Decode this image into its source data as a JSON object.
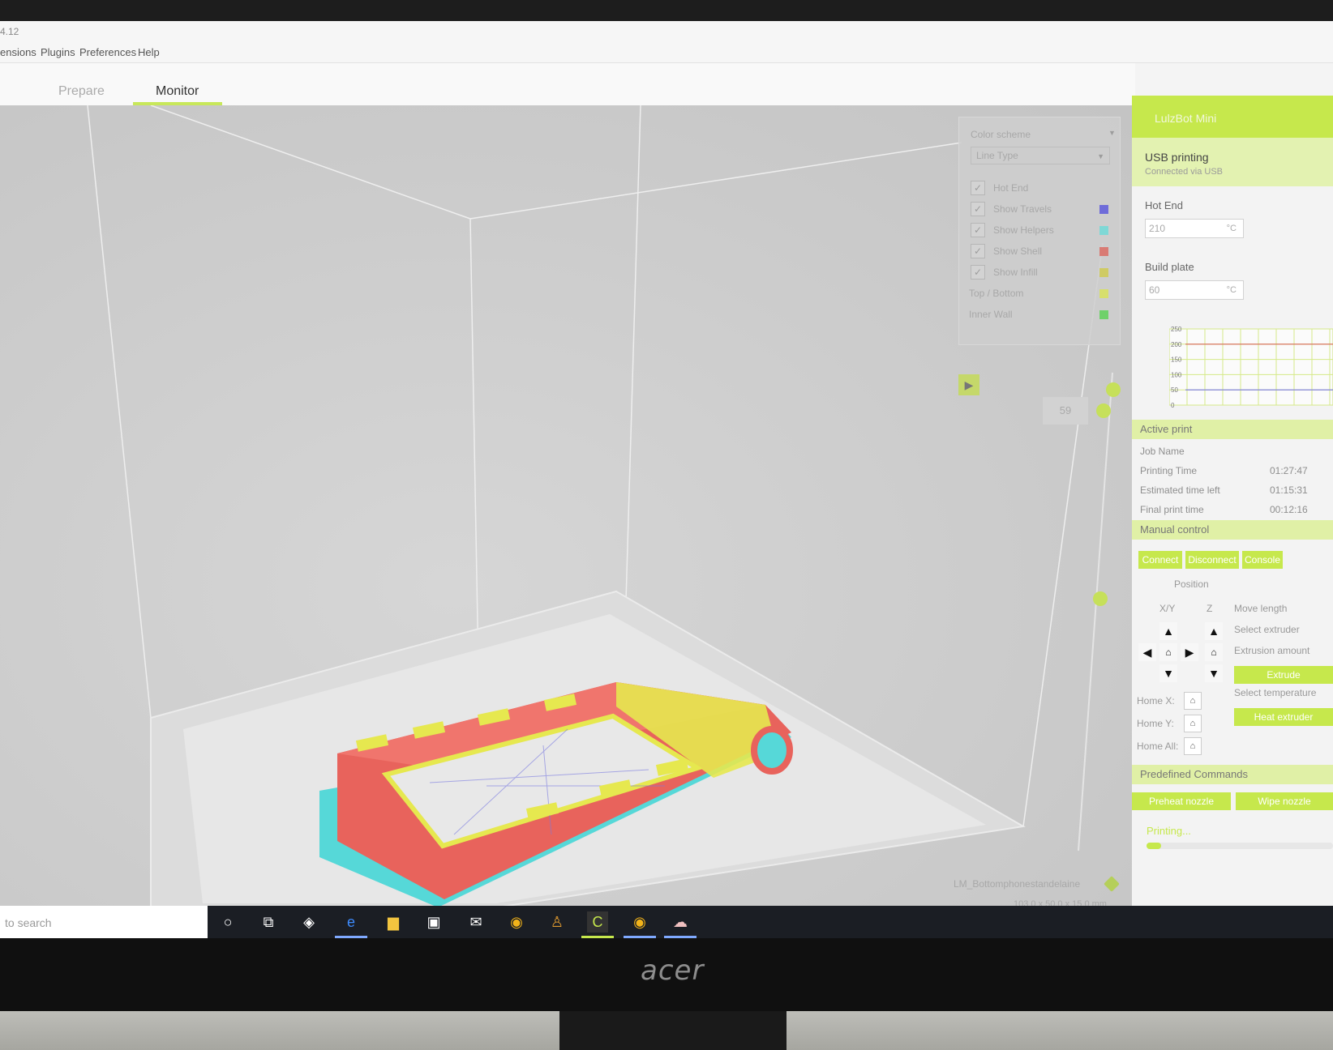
{
  "app": {
    "title_fragment": "4.12"
  },
  "menu": {
    "items": [
      "ensions",
      "Plugins",
      "Preferences",
      "Help"
    ]
  },
  "tabs": [
    "Prepare",
    "Monitor"
  ],
  "view_settings": {
    "color_scheme_label": "Color scheme",
    "color_scheme_value": "Line Type",
    "rows": [
      {
        "label": "Hot End",
        "checked": true,
        "color": ""
      },
      {
        "label": "Show Travels",
        "checked": true,
        "color": "#6f6cd9"
      },
      {
        "label": "Show Helpers",
        "checked": true,
        "color": "#7fd8d6"
      },
      {
        "label": "Show Shell",
        "checked": true,
        "color": "#d97b74"
      },
      {
        "label": "Show Infill",
        "checked": true,
        "color": "#cfcb64"
      },
      {
        "label": "Top / Bottom",
        "checked": false,
        "color": "#d7df6c"
      },
      {
        "label": "Inner Wall",
        "checked": false,
        "color": "#6fd16a"
      }
    ]
  },
  "layer": {
    "value": "59"
  },
  "object": {
    "name": "LM_Bottomphonestandelaine",
    "dimensions": "103.0 x 50.0 x 15.0 mm"
  },
  "printer": {
    "name": "LulzBot Mini",
    "connection_title": "USB printing",
    "connection_subtitle": "Connected via USB",
    "hot_end_label": "Hot End",
    "hot_end_value": "210",
    "build_plate_label": "Build plate",
    "build_plate_value": "60",
    "temp_unit": "°C"
  },
  "temp_graph": {
    "y_ticks": [
      "250",
      "200",
      "150",
      "100",
      "50",
      "0"
    ],
    "hot_end_level": 200,
    "bed_level": 50,
    "y_max": 250
  },
  "active_print": {
    "section_label": "Active print",
    "rows": [
      {
        "label": "Job Name",
        "value": ""
      },
      {
        "label": "Printing Time",
        "value": "01:27:47"
      },
      {
        "label": "Estimated time left",
        "value": "01:15:31"
      },
      {
        "label": "Final print time",
        "value": "00:12:16"
      }
    ]
  },
  "manual_control": {
    "section_label": "Manual control",
    "buttons": [
      "Connect",
      "Disconnect",
      "Console"
    ],
    "position_label": "Position",
    "xy_label": "X/Y",
    "z_label": "Z",
    "move_length_label": "Move length",
    "select_extruder_label": "Select extruder",
    "extrusion_amount_label": "Extrusion amount",
    "extrude_button": "Extrude",
    "select_temperature_label": "Select temperature",
    "heat_extruder_button": "Heat extruder",
    "home_x_label": "Home X:",
    "home_y_label": "Home Y:",
    "home_all_label": "Home All:"
  },
  "predefined": {
    "section_label": "Predefined Commands",
    "buttons": [
      "Preheat nozzle",
      "Wipe nozzle"
    ]
  },
  "status": {
    "label": "Printing...",
    "progress": 0.08
  },
  "taskbar": {
    "search_placeholder": "to search"
  },
  "brand": {
    "monitor_logo": "acer"
  },
  "colors": {
    "accent": "#c6e84c",
    "shell": "#e8635c",
    "skirt": "#56d8d8",
    "infill": "#e6e84f"
  }
}
